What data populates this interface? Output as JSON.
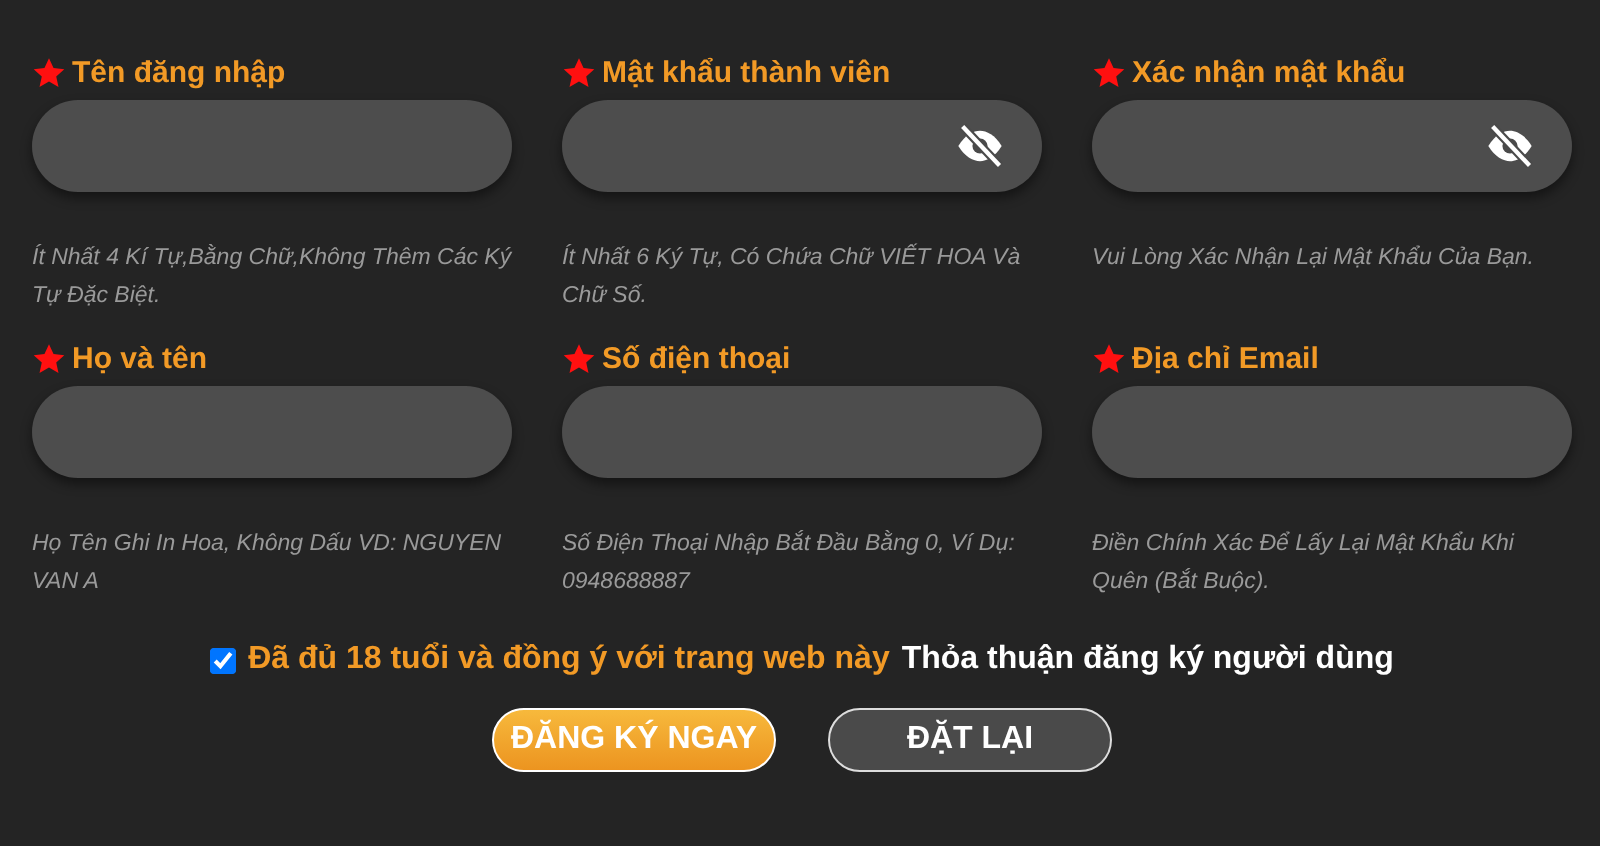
{
  "fields": [
    {
      "label": "Tên đăng nhập",
      "kind": "text",
      "hint": "Ít Nhất 4 Kí Tự,Bằng Chữ,Không Thêm Các Ký Tự Đặc Biệt."
    },
    {
      "label": "Mật khẩu thành viên",
      "kind": "password",
      "hint": "Ít Nhất 6 Ký Tự, Có Chứa Chữ VIẾT HOA Và Chữ Số."
    },
    {
      "label": "Xác nhận mật khẩu",
      "kind": "password",
      "hint": "Vui Lòng Xác Nhận Lại Mật Khẩu Của Bạn."
    },
    {
      "label": "Họ và tên",
      "kind": "text",
      "hint": "Họ Tên Ghi In Hoa, Không Dấu VD: NGUYEN VAN A"
    },
    {
      "label": "Số điện thoại",
      "kind": "text",
      "hint": "Số Điện Thoại Nhập Bắt Đầu Bằng 0, Ví Dụ: 0948688887"
    },
    {
      "label": "Địa chỉ Email",
      "kind": "text",
      "hint": "Điền Chính Xác Để Lấy Lại Mật Khẩu Khi Quên (Bắt Buộc)."
    }
  ],
  "agreement": {
    "checked": true,
    "text": "Đã đủ 18 tuổi và đồng ý với trang web này",
    "link": "Thỏa thuận đăng ký người dùng"
  },
  "buttons": [
    {
      "label": "ĐĂNG KÝ NGAY",
      "kind": "primary"
    },
    {
      "label": "ĐẶT LẠI",
      "kind": "secondary"
    }
  ]
}
